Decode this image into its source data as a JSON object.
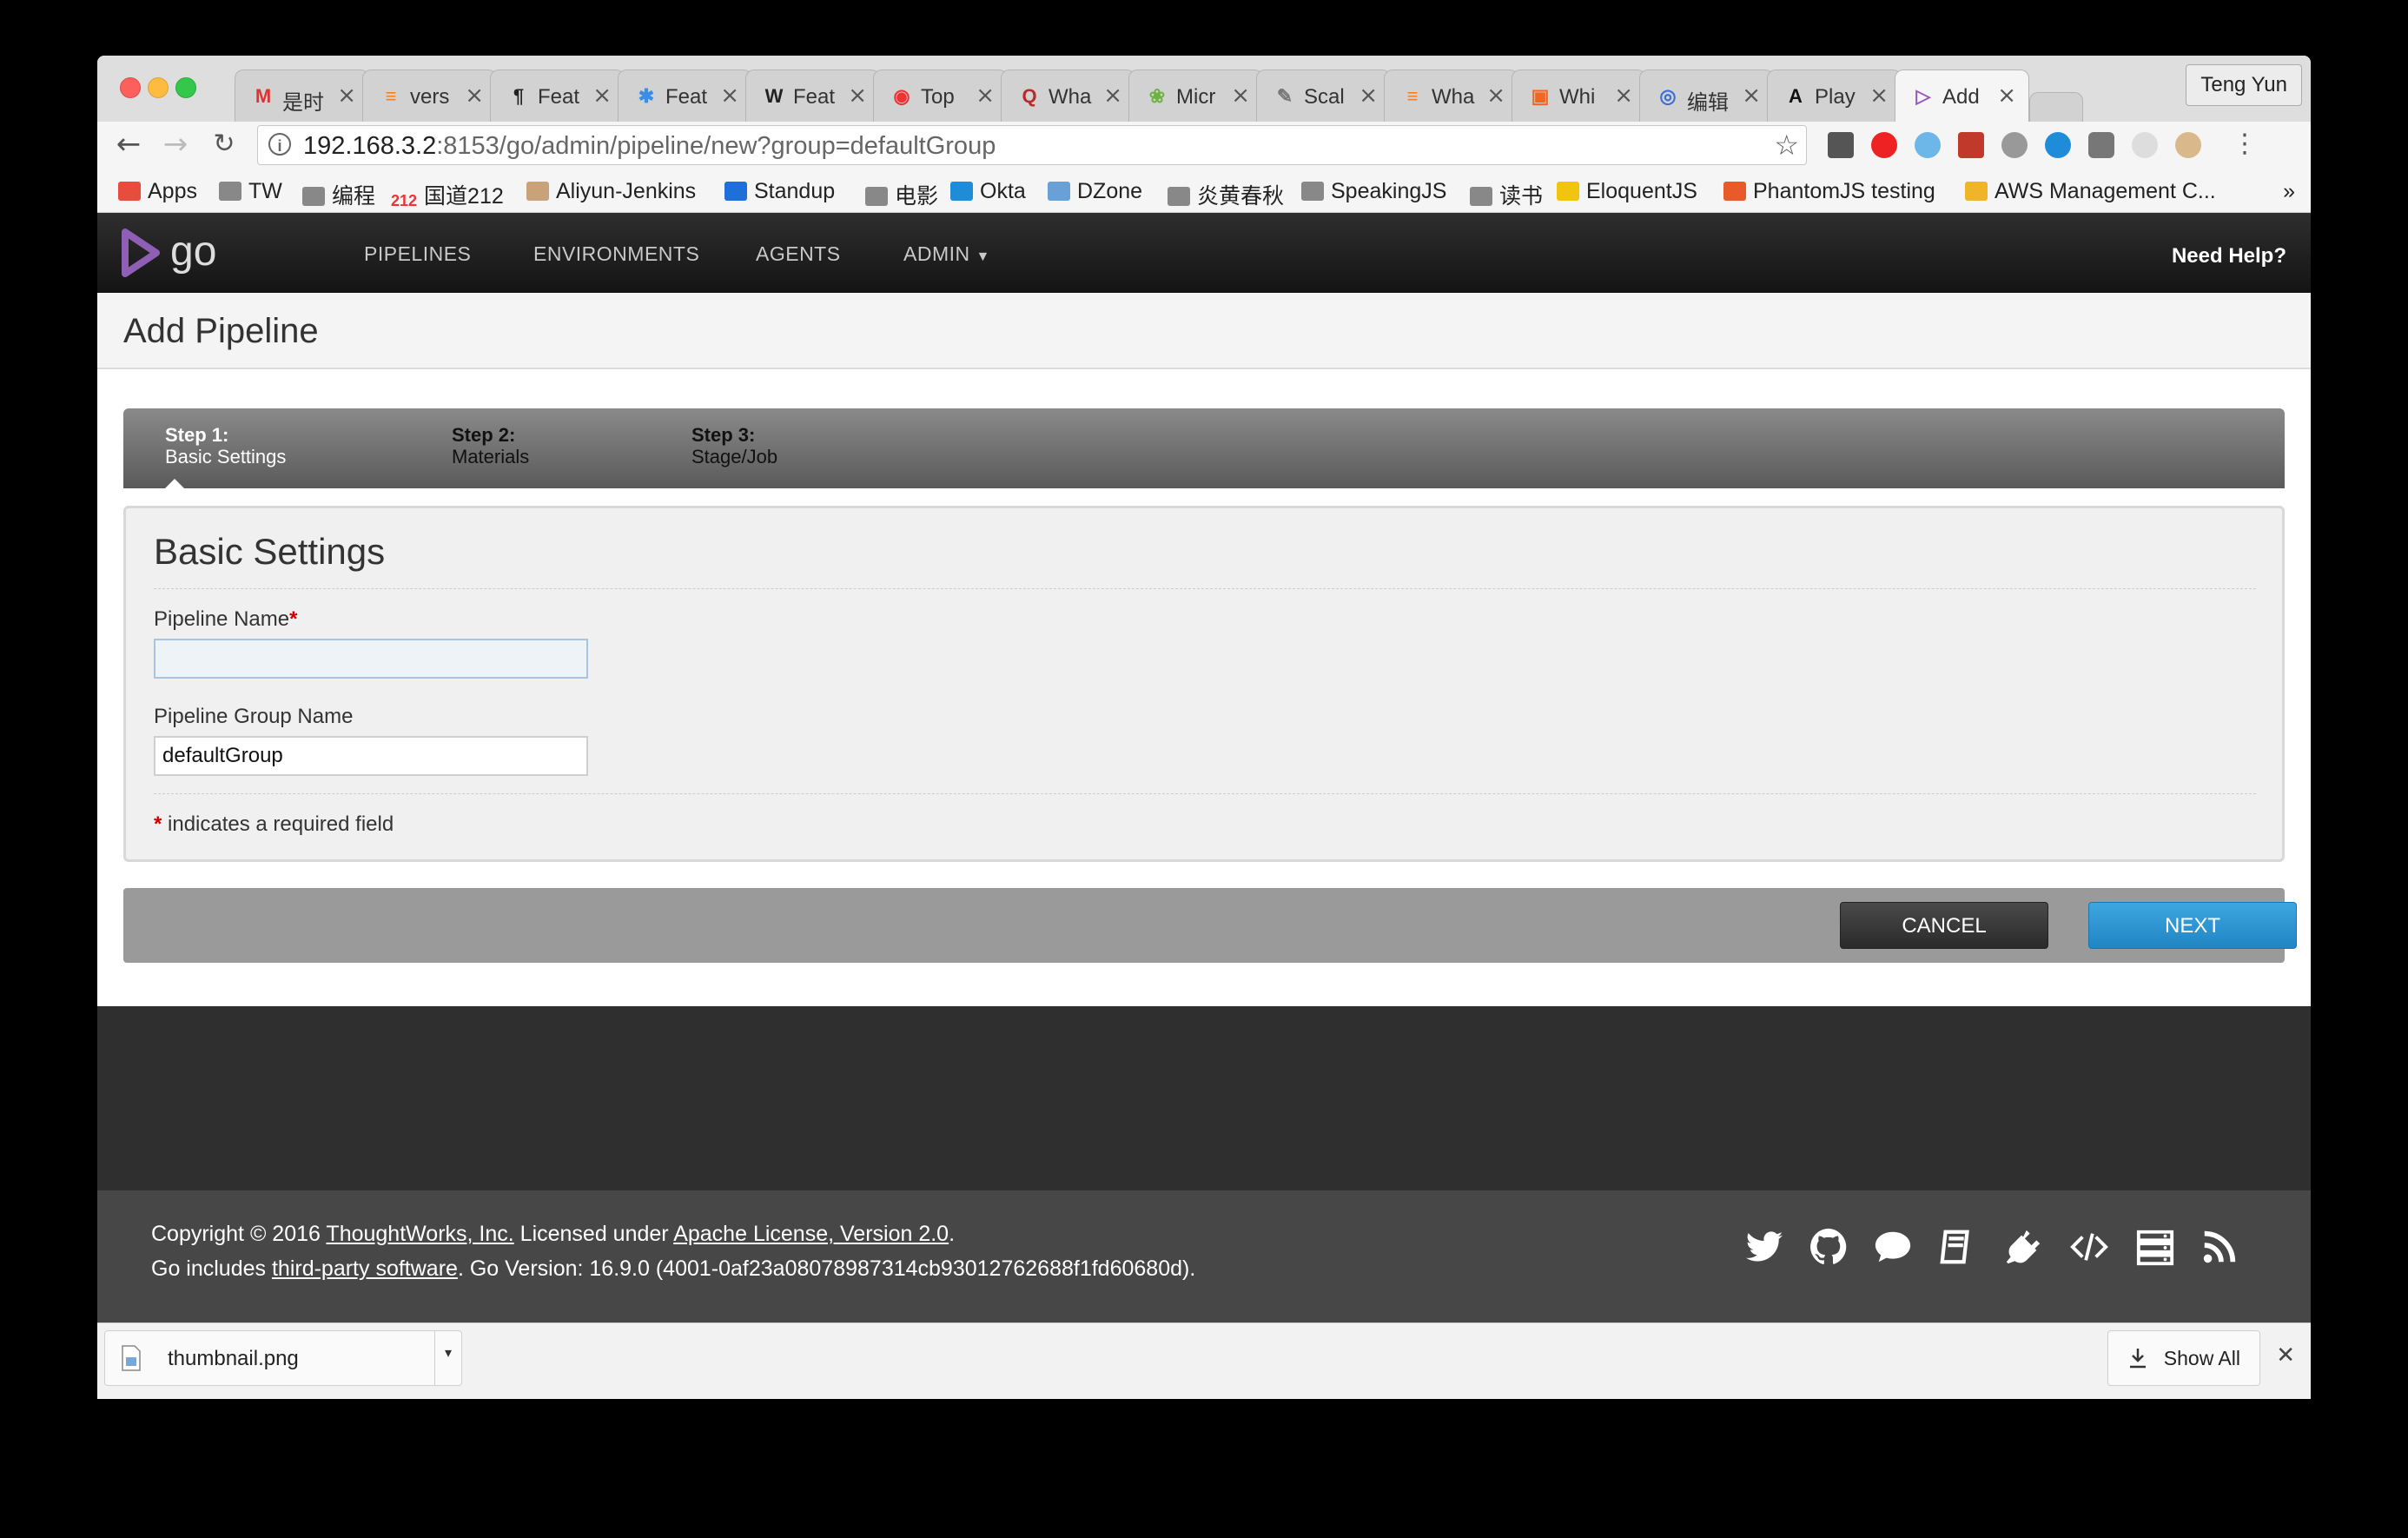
{
  "browser": {
    "tabs": [
      {
        "label": "是时",
        "icon": "gmail-icon",
        "color": "#d33"
      },
      {
        "label": "vers",
        "icon": "stackoverflow-icon",
        "color": "#f48024"
      },
      {
        "label": "Feat",
        "icon": "sql-icon",
        "color": "#222"
      },
      {
        "label": "Feat",
        "icon": "dzone-icon",
        "color": "#3a8ee6"
      },
      {
        "label": "Feat",
        "icon": "wikipedia-icon",
        "color": "#222"
      },
      {
        "label": "Top",
        "icon": "top-icon",
        "color": "#e33"
      },
      {
        "label": "Wha",
        "icon": "quora-icon",
        "color": "#b92b27"
      },
      {
        "label": "Micr",
        "icon": "spring-icon",
        "color": "#6db33f"
      },
      {
        "label": "Scal",
        "icon": "scala-icon",
        "color": "#777"
      },
      {
        "label": "Wha",
        "icon": "stackoverflow-icon",
        "color": "#f48024"
      },
      {
        "label": "Whi",
        "icon": "slack-icon",
        "color": "#f26522"
      },
      {
        "label": "编辑",
        "icon": "editor-icon",
        "color": "#3a6fd8"
      },
      {
        "label": "Play",
        "icon": "ansible-icon",
        "color": "#111"
      },
      {
        "label": "Add",
        "icon": "go-icon",
        "color": "#9b59b6"
      }
    ],
    "profile": "Teng Yun",
    "url_host": "192.168.3.2",
    "url_path": ":8153/go/admin/pipeline/new?group=defaultGroup",
    "bookmarks": [
      "Apps",
      "TW",
      "编程",
      "国道212",
      "Aliyun-Jenkins",
      "Standup",
      "电影",
      "Okta",
      "DZone",
      "炎黄春秋",
      "SpeakingJS",
      "读书",
      "EloquentJS",
      "PhantomJS testing",
      "AWS Management C..."
    ],
    "bookmark_212_badge": "212",
    "bookmarks_more": "»"
  },
  "go": {
    "logo_text": "go",
    "nav": [
      "PIPELINES",
      "ENVIRONMENTS",
      "AGENTS",
      "ADMIN"
    ],
    "admin_caret": "▼",
    "help": "Need Help?"
  },
  "page": {
    "title": "Add Pipeline",
    "steps": [
      {
        "num": "Step 1:",
        "name": "Basic Settings",
        "active": true
      },
      {
        "num": "Step 2:",
        "name": "Materials",
        "active": false
      },
      {
        "num": "Step 3:",
        "name": "Stage/Job",
        "active": false
      }
    ],
    "section_title": "Basic Settings",
    "pipeline_name_label": "Pipeline Name",
    "required_star": "*",
    "pipeline_name_value": "",
    "group_name_label": "Pipeline Group Name",
    "group_name_value": "defaultGroup",
    "required_note": "indicates a required field",
    "cancel": "CANCEL",
    "next": "NEXT"
  },
  "footer": {
    "copyright_prefix": "Copyright © 2016 ",
    "company": "ThoughtWorks, Inc.",
    "licensed": " Licensed under ",
    "license": "Apache License, Version 2.0",
    "period": ".",
    "includes_prefix": "Go includes ",
    "third_party": "third-party software",
    "version": ". Go Version: 16.9.0 (4001-0af23a08078987314cb93012762688f1fd60680d)."
  },
  "download": {
    "file": "thumbnail.png",
    "show_all": "Show All"
  },
  "colors": {
    "accent_blue": "#2a93d5",
    "go_purple": "#8e5fb5",
    "required_red": "#cc0000"
  }
}
